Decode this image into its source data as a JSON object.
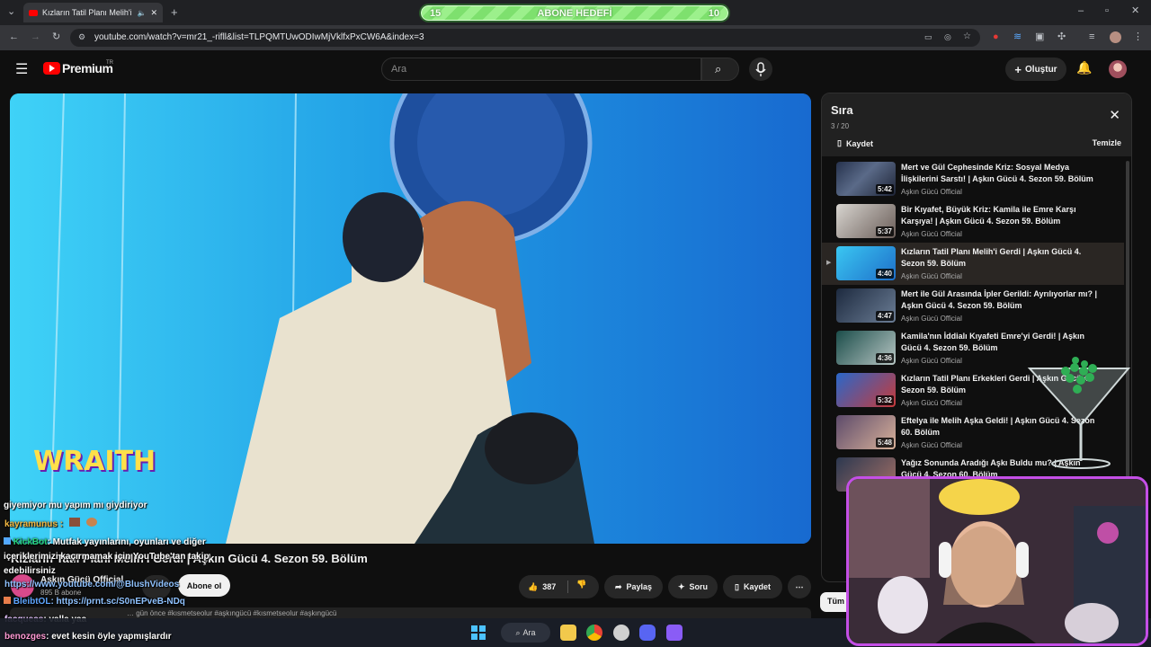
{
  "browser": {
    "tab_title": "Kızların Tatil Planı Melih'i Gerdi | Aşkın Gücü 4. Sezon 59. Bölüm",
    "url": "youtube.com/watch?v=mr21_-rifll&list=TLPQMTUwODIwMjVklfxPxCW6A&index=3"
  },
  "goal_overlay": {
    "left_value": "15",
    "label": "ABONE HEDEFİ",
    "right_value": "10"
  },
  "masthead": {
    "logo_text": "Premium",
    "logo_badge": "TR",
    "search_placeholder": "Ara",
    "create_label": "Oluştur"
  },
  "video": {
    "overlay_logo": "WRAITH",
    "title": "Kızların Tatil Planı Melih'i Gerdi | Aşkın Gücü 4. Sezon 59. Bölüm",
    "channel": "Aşkın Gücü Official",
    "subscribers": "895 B abone",
    "subscribe_label": "Abone ol",
    "likes": "387",
    "share_label": "Paylaş",
    "ask_label": "Soru",
    "save_label": "Kaydet",
    "meta_text": "… gün önce #kısmetseolur #aşkıngücü #kısmetseolur #aşkıngücü"
  },
  "playlist": {
    "title": "Sıra",
    "count": "3 / 20",
    "save_label": "Kaydet",
    "clear_label": "Temizle",
    "items": [
      {
        "title": "Mert ve Gül Cephesinde Kriz: Sosyal Medya İlişkilerini Sarstı! | Aşkın Gücü 4. Sezon 59. Bölüm",
        "channel": "Aşkın Gücü Official",
        "duration": "5:42"
      },
      {
        "title": "Bir Kıyafet, Büyük Kriz: Kamila ile Emre Karşı Karşıya! | Aşkın Gücü 4. Sezon 59. Bölüm",
        "channel": "Aşkın Gücü Official",
        "duration": "5:37"
      },
      {
        "title": "Kızların Tatil Planı Melih'i Gerdi | Aşkın Gücü 4. Sezon 59. Bölüm",
        "channel": "Aşkın Gücü Official",
        "duration": "4:40"
      },
      {
        "title": "Mert ile Gül Arasında İpler Gerildi: Ayrılıyorlar mı? | Aşkın Gücü 4. Sezon 59. Bölüm",
        "channel": "Aşkın Gücü Official",
        "duration": "4:47"
      },
      {
        "title": "Kamila'nın İddialı Kıyafeti Emre'yi Gerdi! | Aşkın Gücü 4. Sezon 59. Bölüm",
        "channel": "Aşkın Gücü Official",
        "duration": "4:36"
      },
      {
        "title": "Kızların Tatil Planı Erkekleri Gerdi | Aşkın Gücü 4. Sezon 59. Bölüm",
        "channel": "Aşkın Gücü Official",
        "duration": "5:32"
      },
      {
        "title": "Eftelya ile Melih Aşka Geldi! | Aşkın Gücü 4. Sezon 60. Bölüm",
        "channel": "Aşkın Gücü Official",
        "duration": "5:48"
      },
      {
        "title": "Yağız Sonunda Aradığı Aşkı Buldu mu? | Aşkın Gücü 4. Sezon 60. Bölüm",
        "channel": "",
        "duration": ""
      }
    ],
    "bottom_chip": "Tüm"
  },
  "chat": {
    "messages": [
      {
        "user": "",
        "text": "giyemiyor mu yapım mı giydiriyor"
      },
      {
        "user": "kayramunus :",
        "text": ""
      },
      {
        "user": "KickBot",
        "text": ": Mutfak yayınlarını, oyunları ve diğer içeriklerimizi kaçırmamak için YouTube'tan takip edebilirsiniz"
      },
      {
        "user": "",
        "text": "https://www.youtube.com/@BlushVideos"
      },
      {
        "user": "BleibtOL",
        "text": ": https://prnt.sc/S0nEPveB-NDq"
      },
      {
        "user": "facqueas",
        "text": ": valla yaa"
      },
      {
        "user": "benozges",
        "text": ": evet kesin öyle yapmışlardır"
      }
    ]
  },
  "taskbar": {
    "search_label": "Ara"
  },
  "colors": {
    "accent_red": "#ff0000",
    "facecam_border": "#c44fe6",
    "goal_green": "#9cf08c"
  }
}
